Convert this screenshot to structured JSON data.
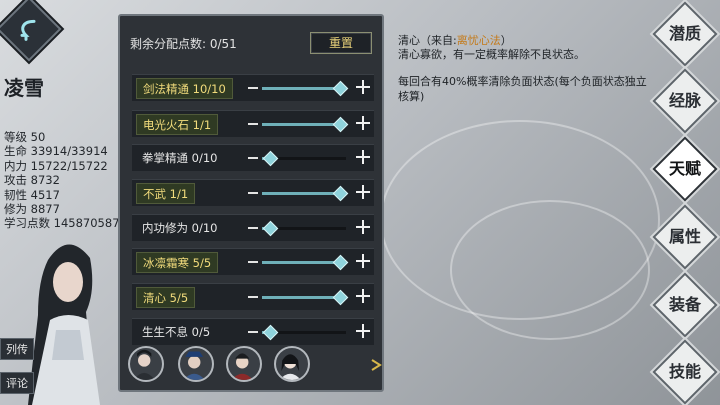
{
  "character": {
    "name": "凌雪",
    "stats": [
      "等级 50",
      "生命 33914/33914",
      "内力 15722/15722",
      "攻击 8732",
      "韧性 4517",
      "修为 8877",
      "学习点数 145870587"
    ]
  },
  "side_tabs": [
    "列传",
    "评论"
  ],
  "panel": {
    "remaining_label": "剩余分配点数: 0/51",
    "reset_label": "重置"
  },
  "talents": [
    {
      "label": "剑法精通 10/10",
      "level": 1.0,
      "active": true
    },
    {
      "label": "电光火石 1/1",
      "level": 1.0,
      "active": true
    },
    {
      "label": "拳掌精通 0/10",
      "level": 0.0,
      "active": false
    },
    {
      "label": "不武 1/1",
      "level": 1.0,
      "active": true
    },
    {
      "label": "内功修为 0/10",
      "level": 0.0,
      "active": false
    },
    {
      "label": "冰凛霜寒 5/5",
      "level": 1.0,
      "active": true
    },
    {
      "label": "清心 5/5",
      "level": 1.0,
      "active": true
    },
    {
      "label": "生生不息 0/5",
      "level": 0.0,
      "active": false
    }
  ],
  "description": {
    "title_prefix": "清心（来自:",
    "source": "离忧心法",
    "title_suffix": "）",
    "text": "清心寡欲，有一定概率解除不良状态。",
    "effect": "每回合有40%概率清除负面状态(每个负面状态独立核算)"
  },
  "right_tabs": [
    {
      "label": "潜质",
      "selected": false
    },
    {
      "label": "经脉",
      "selected": false
    },
    {
      "label": "天赋",
      "selected": true
    },
    {
      "label": "属性",
      "selected": false
    },
    {
      "label": "装备",
      "selected": false
    },
    {
      "label": "技能",
      "selected": false
    }
  ],
  "colors": {
    "panel_bg": "#2e3237",
    "active_text": "#f2dc7c",
    "slider": "#8fd3dc",
    "source_text": "#c47a19"
  }
}
